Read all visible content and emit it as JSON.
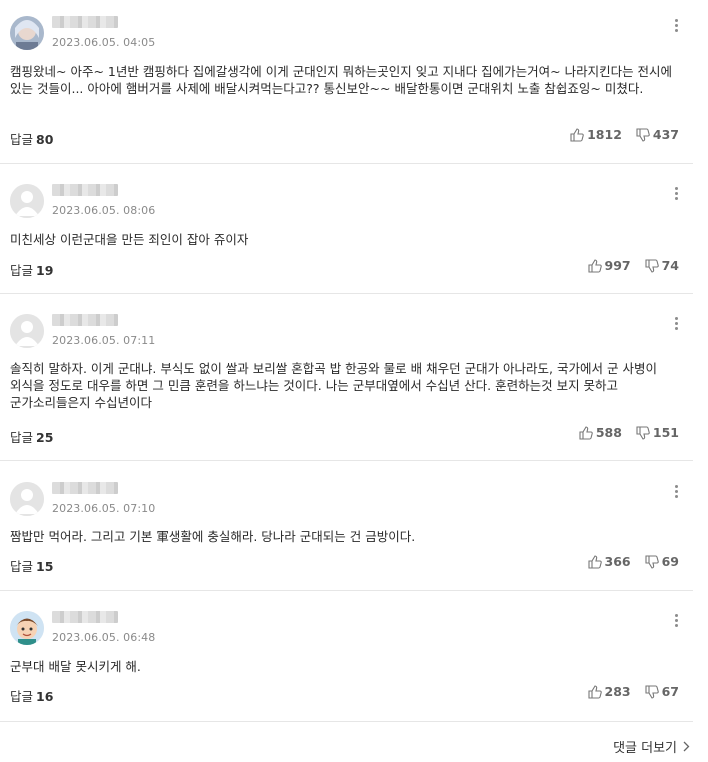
{
  "comments": [
    {
      "avatar": "character-avatar",
      "date": "2023.06.05. 04:05",
      "text": "캠핑왔네~ 아주~ 1년반 캠핑하다 집에갈생각에 이게 군대인지 뭐하는곳인지 잊고 지내다 집에가는거여~ 나라지킨다는 전시에 있는 것들이... 아아에 햄버거를 사제에 배달시켜먹는다고?? 통신보안~~ 배달한통이면 군대위치 노출 참쉽죠잉~ 미쳤다.",
      "reply_label": "답글",
      "reply_count": "80",
      "likes": "1812",
      "dislikes": "437"
    },
    {
      "avatar": "default-avatar",
      "date": "2023.06.05. 08:06",
      "text": "미친세상 이런군대을 만든 죄인이 잡아 쥬이자",
      "reply_label": "답글",
      "reply_count": "19",
      "likes": "997",
      "dislikes": "74"
    },
    {
      "avatar": "default-avatar",
      "date": "2023.06.05. 07:11",
      "text": "솔직히 말하자. 이게 군대냐. 부식도 없이 쌀과 보리쌀 혼합곡 밥 한공와 물로 배 채우던 군대가 아나라도, 국가에서 군 사병이 외식을 정도로 대우를 하면 그 민큼 훈련을 하느냐는 것이다. 나는 군부대옆에서 수십년 산다. 훈련하는것 보지 못하고 군가소리들은지 수십년이다",
      "reply_label": "답글",
      "reply_count": "25",
      "likes": "588",
      "dislikes": "151"
    },
    {
      "avatar": "default-avatar",
      "date": "2023.06.05. 07:10",
      "text": "짬밥만 먹어라. 그리고 기본 軍생활에 충실해라. 당나라 군대되는 건 금방이다.",
      "reply_label": "답글",
      "reply_count": "15",
      "likes": "366",
      "dislikes": "69"
    },
    {
      "avatar": "cartoon-avatar",
      "date": "2023.06.05. 06:48",
      "text": "군부대 배달 못시키게 해.",
      "reply_label": "답글",
      "reply_count": "16",
      "likes": "283",
      "dislikes": "67"
    }
  ],
  "more_comments_label": "댓글 더보기"
}
